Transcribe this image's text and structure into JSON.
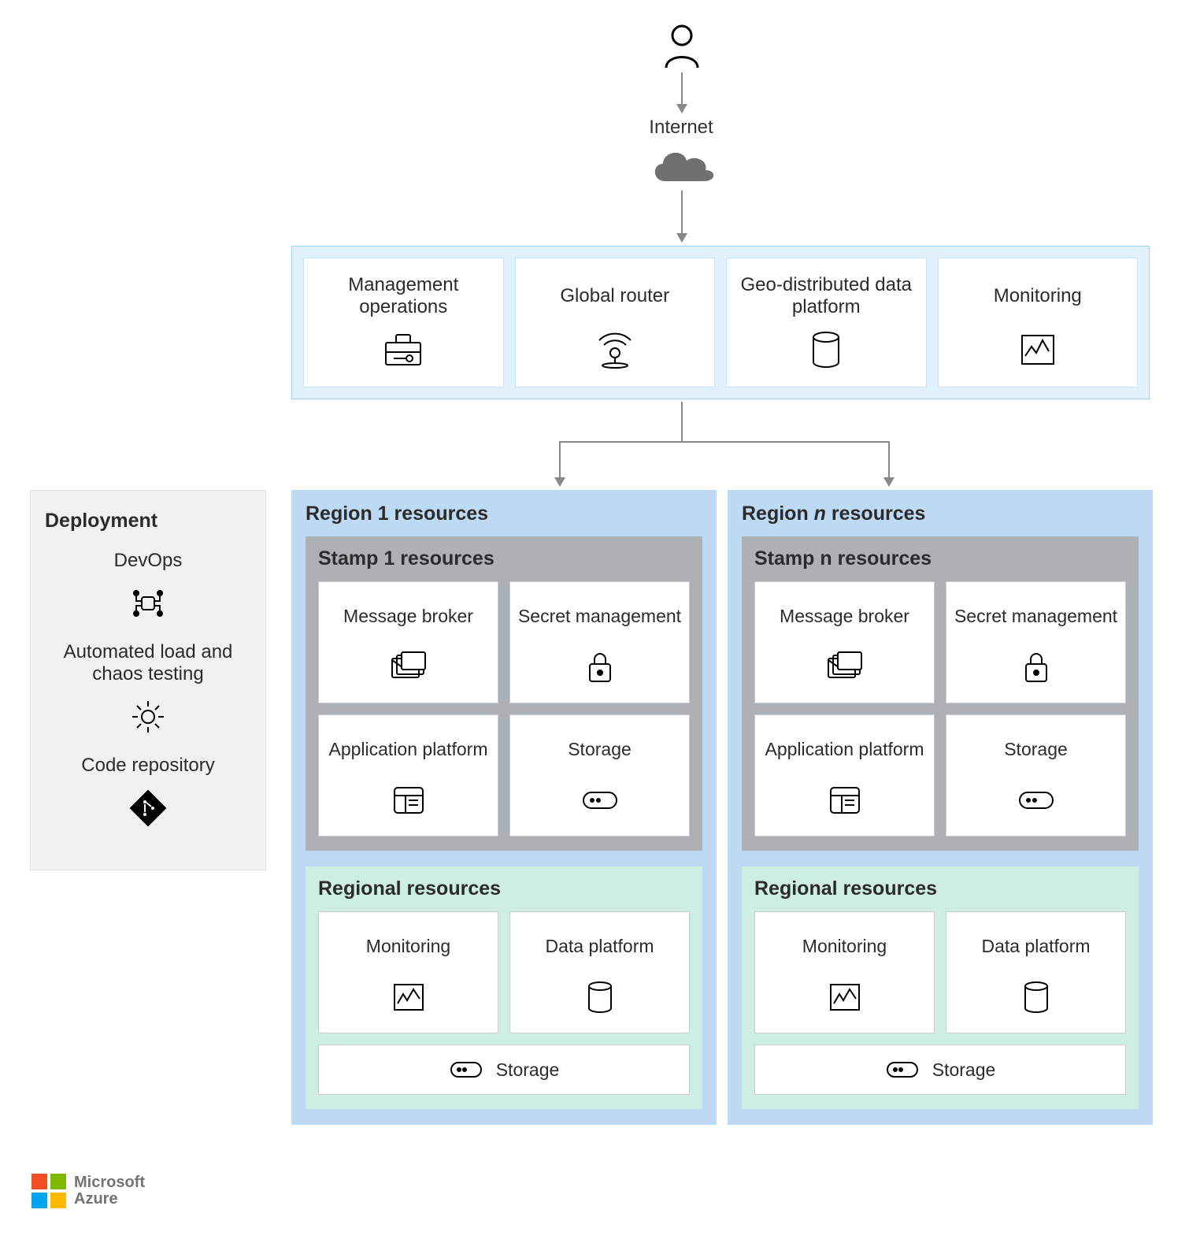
{
  "top": {
    "internet": "Internet"
  },
  "global": {
    "management": "Management operations",
    "router": "Global router",
    "geo": "Geo-distributed data platform",
    "monitoring": "Monitoring"
  },
  "deployment": {
    "title": "Deployment",
    "devops": "DevOps",
    "testing": "Automated load and chaos testing",
    "repo": "Code repository"
  },
  "region1": {
    "title": "Region 1 resources",
    "stamp_title": "Stamp 1 resources",
    "broker": "Message broker",
    "secret": "Secret management",
    "app": "Application platform",
    "storage": "Storage",
    "regional_title": "Regional resources",
    "monitoring": "Monitoring",
    "data": "Data platform",
    "storage2": "Storage"
  },
  "regionN": {
    "title_prefix": "Region ",
    "title_var": "n",
    "title_suffix": " resources",
    "stamp_title": "Stamp n resources",
    "broker": "Message broker",
    "secret": "Secret management",
    "app": "Application platform",
    "storage": "Storage",
    "regional_title": "Regional resources",
    "monitoring": "Monitoring",
    "data": "Data platform",
    "storage2": "Storage"
  },
  "brand": {
    "line1": "Microsoft",
    "line2": "Azure"
  }
}
